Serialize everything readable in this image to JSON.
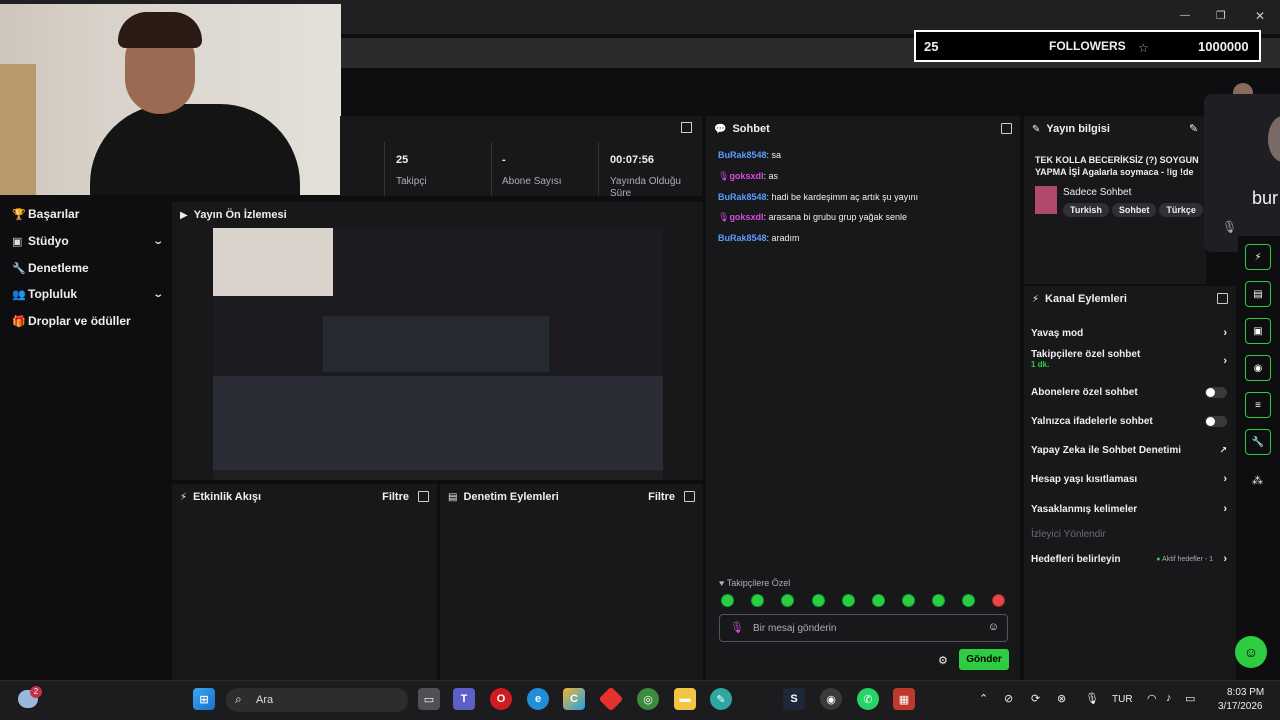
{
  "overlay": {
    "count": "25",
    "label": "FOLLOWERS",
    "goal": "1000000"
  },
  "window": {
    "min": "—",
    "max": "❐",
    "close": "✕"
  },
  "stats": [
    {
      "value": "25",
      "label": "Takipçi"
    },
    {
      "value": "-",
      "label": "Abone Sayısı"
    },
    {
      "value": "00:07:56",
      "label": "Yayında Olduğu Süre"
    }
  ],
  "nav": {
    "items": [
      {
        "label": "Başarılar"
      },
      {
        "label": "Stüdyo"
      },
      {
        "label": "Denetleme"
      },
      {
        "label": "Topluluk"
      },
      {
        "label": "Droplar ve ödüller"
      }
    ]
  },
  "preview": {
    "title": "Yayın Ön İzlemesi"
  },
  "activity": {
    "title": "Etkinlik Akışı",
    "filter": "Filtre"
  },
  "modlog": {
    "title": "Denetim Eylemleri",
    "filter": "Filtre"
  },
  "chat": {
    "title": "Sohbet",
    "messages": [
      {
        "user": "BuRak8548",
        "text": ": sa",
        "color": "#5b9cff"
      },
      {
        "user": "goksxdl",
        "text": ": as",
        "color": "#d84ae0"
      },
      {
        "user": "BuRak8548",
        "text": ": hadi be kardeşimm aç artık şu yayını",
        "color": "#5b9cff"
      },
      {
        "user": "goksxdl",
        "text": ": arasana bi grubu grup yağak senle",
        "color": "#d84ae0"
      },
      {
        "user": "BuRak8548",
        "text": ": aradım",
        "color": "#5b9cff"
      }
    ],
    "followers_only": "Takipçilere Özel",
    "placeholder": "Bir mesaj gönderin",
    "send": "Gönder"
  },
  "streaminfo": {
    "title": "Yayın bilgisi",
    "stream_title": "TEK KOLLA BECERİKSİZ (?) SOYGUN YAPMA İŞİ Agalarla soymaca - !ig !de",
    "category": "Sadece Sohbet",
    "tags": [
      "Turkish",
      "Sohbet",
      "Türkçe"
    ]
  },
  "channel_actions": {
    "title": "Kanal Eylemleri",
    "slow": "Yavaş mod",
    "followers_chat": "Takipçilere özel sohbet",
    "followers_sub": "1 dk.",
    "subs_chat": "Abonelere özel sohbet",
    "emote_chat": "Yalnızca ifadelerle sohbet",
    "ai": "Yapay Zeka ile Sohbet Denetimi",
    "age": "Hesap yaşı kısıtlaması",
    "banned": "Yasaklanmış kelimeler",
    "redirect": "İzleyici Yönlendir",
    "goals": "Hedefleri belirleyin",
    "goals_badge": "Aktif hedefler - 1"
  },
  "taskbar": {
    "search": "Ara",
    "lang": "TUR",
    "time": "8:03 PM",
    "date": "3/17/2026",
    "badge": "2"
  },
  "side_name": "bur",
  "colors": {
    "accent": "#2ecc40",
    "bg": "#0e0e10",
    "panel": "#18181b",
    "purple": "#9147ff"
  }
}
